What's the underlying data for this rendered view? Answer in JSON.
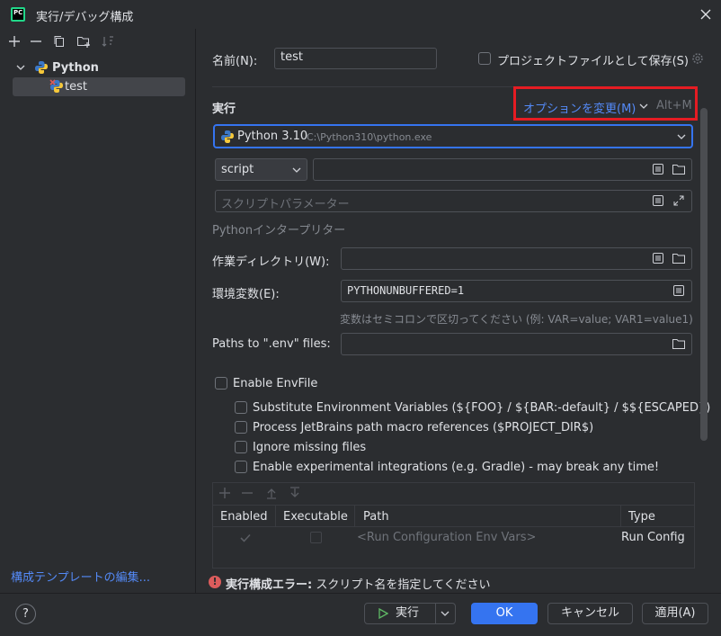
{
  "window": {
    "title": "実行/デバッグ構成"
  },
  "colors": {
    "accent": "#3574f0",
    "link": "#548af7",
    "error": "#db5c5c",
    "highlight_box": "#e51c23"
  },
  "left_panel": {
    "toolbar_icons": [
      "add-icon",
      "remove-icon",
      "copy-icon",
      "new-folder-icon",
      "sort-icon"
    ],
    "tree": {
      "group": "Python",
      "item": "test"
    },
    "edit_templates": "構成テンプレートの編集..."
  },
  "form": {
    "name_label": "名前(N):",
    "name_value": "test",
    "save_as_project_file": "プロジェクトファイルとして保存(S)",
    "run_section_title": "実行",
    "modify_options": "オプションを変更(M)",
    "modify_shortcut": "Alt+M",
    "interpreter": {
      "name": "Python 3.10",
      "path": "C:\\Python310\\python.exe"
    },
    "script_type": "script",
    "script_path": "",
    "params_placeholder": "スクリプトパラメーター",
    "interpreter_hint": "Pythonインタープリター",
    "workdir_label": "作業ディレクトリ(W):",
    "workdir_value": "",
    "env_label": "環境変数(E):",
    "env_value": "PYTHONUNBUFFERED=1",
    "env_hint": "変数はセミコロンで区切ってください (例: VAR=value; VAR1=value1)",
    "dotenv_label": "Paths to \".env\" files:",
    "enable_envfile": "Enable EnvFile",
    "envfile_options": [
      "Substitute Environment Variables (${FOO} / ${BAR:-default} / $${ESCAPED})",
      "Process JetBrains path macro references ($PROJECT_DIR$)",
      "Ignore missing files",
      "Enable experimental integrations (e.g. Gradle) - may break any time!"
    ]
  },
  "env_table": {
    "columns": [
      "Enabled",
      "Executable",
      "Path",
      "Type"
    ],
    "rows": [
      {
        "enabled": true,
        "executable": false,
        "path": "<Run Configuration Env Vars>",
        "type": "Run Config"
      }
    ]
  },
  "error": {
    "title": "実行構成エラー:",
    "message": " スクリプト名を指定してください"
  },
  "buttons": {
    "help": "?",
    "run": "実行",
    "ok": "OK",
    "cancel": "キャンセル",
    "apply": "適用(A)"
  }
}
